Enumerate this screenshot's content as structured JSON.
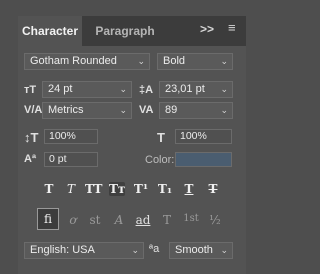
{
  "tabs": [
    "Character",
    "Paragraph"
  ],
  "tab_icons": ">>",
  "menu_icon": "≡",
  "font_family": "Gotham Rounded",
  "font_style": "Bold",
  "font_size": "24 pt",
  "leading": "23,01 pt",
  "kerning": "Metrics",
  "tracking": "89",
  "vertical_scale": "100%",
  "horizontal_scale": "100%",
  "baseline_shift": "0 pt",
  "color_label": "Color:",
  "color_value": "#4a5d70",
  "type_buttons": [
    "T",
    "T",
    "TT",
    "Tт",
    "T¹",
    "T₁",
    "T",
    "T"
  ],
  "opentype_buttons": [
    "fi",
    "ơ",
    "st",
    "A",
    "ad",
    "T",
    "1st",
    "½"
  ],
  "language": "English: USA",
  "antialias_icon": "ªa",
  "antialias": "Smooth"
}
